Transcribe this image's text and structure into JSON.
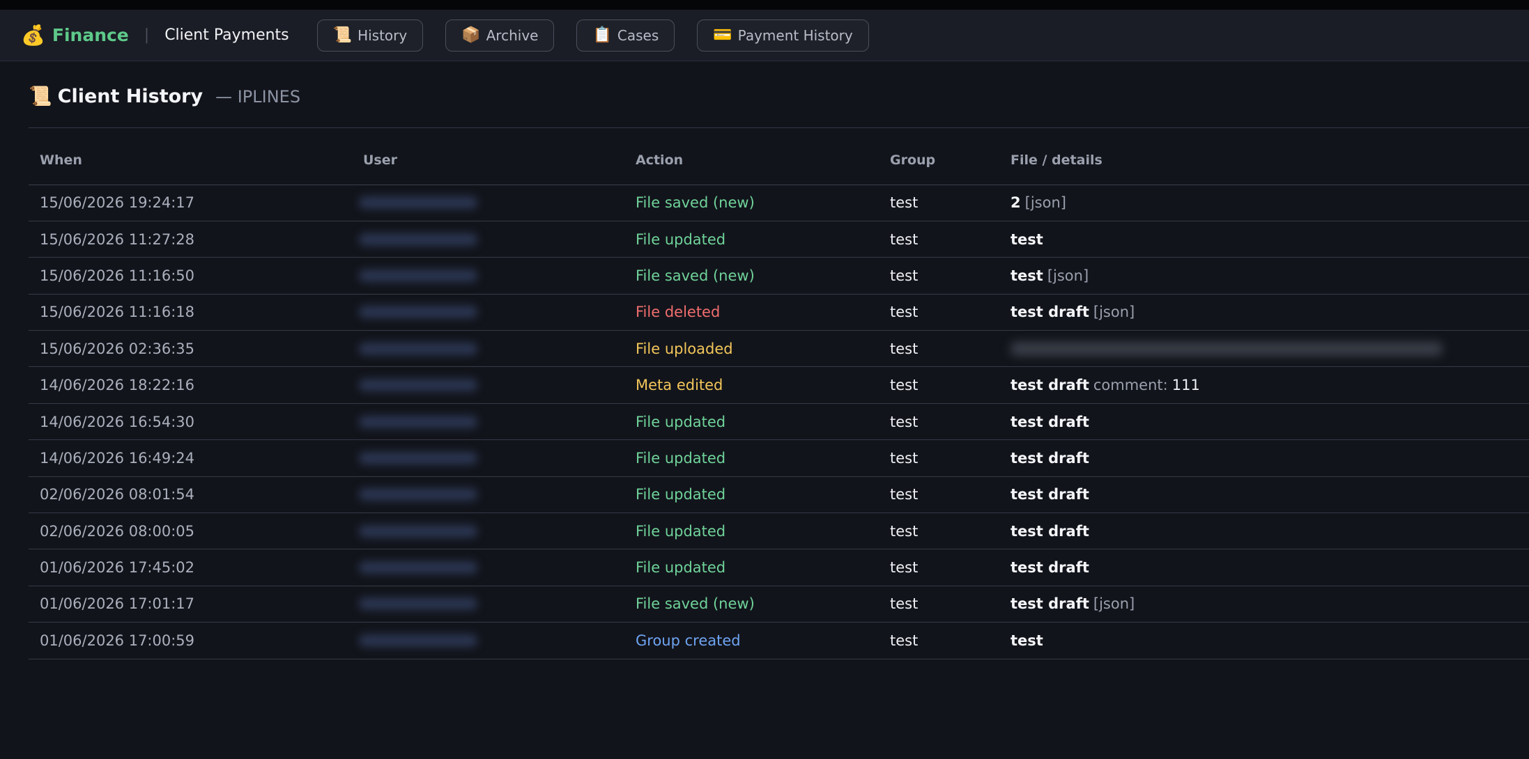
{
  "nav": {
    "brand_icon": "💰",
    "brand": "Finance",
    "separator": "|",
    "title": "Client Payments",
    "buttons": [
      {
        "icon": "📜",
        "label": "History"
      },
      {
        "icon": "📦",
        "label": "Archive"
      },
      {
        "icon": "📋",
        "label": "Cases"
      },
      {
        "icon": "💳",
        "label": "Payment History"
      }
    ]
  },
  "page": {
    "icon": "📜",
    "title": "Client History",
    "subtitle": "— IPLINES"
  },
  "table": {
    "columns": [
      "When",
      "User",
      "Action",
      "Group",
      "File / details"
    ],
    "rows": [
      {
        "when": "15/06/2026 19:24:17",
        "action": "File saved (new)",
        "action_color": "green",
        "group": "test",
        "file": "2",
        "meta": "[json]",
        "comment_label": "",
        "comment_value": "",
        "redacted": false
      },
      {
        "when": "15/06/2026 11:27:28",
        "action": "File updated",
        "action_color": "green",
        "group": "test",
        "file": "test",
        "meta": "",
        "comment_label": "",
        "comment_value": "",
        "redacted": false
      },
      {
        "when": "15/06/2026 11:16:50",
        "action": "File saved (new)",
        "action_color": "green",
        "group": "test",
        "file": "test",
        "meta": "[json]",
        "comment_label": "",
        "comment_value": "",
        "redacted": false
      },
      {
        "when": "15/06/2026 11:16:18",
        "action": "File deleted",
        "action_color": "red",
        "group": "test",
        "file": "test draft",
        "meta": "[json]",
        "comment_label": "",
        "comment_value": "",
        "redacted": false
      },
      {
        "when": "15/06/2026 02:36:35",
        "action": "File uploaded",
        "action_color": "yellow",
        "group": "test",
        "file": "",
        "meta": "",
        "comment_label": "",
        "comment_value": "",
        "redacted": true
      },
      {
        "when": "14/06/2026 18:22:16",
        "action": "Meta edited",
        "action_color": "yellow",
        "group": "test",
        "file": "test draft",
        "meta": "",
        "comment_label": "comment:",
        "comment_value": "111",
        "redacted": false
      },
      {
        "when": "14/06/2026 16:54:30",
        "action": "File updated",
        "action_color": "green",
        "group": "test",
        "file": "test draft",
        "meta": "",
        "comment_label": "",
        "comment_value": "",
        "redacted": false
      },
      {
        "when": "14/06/2026 16:49:24",
        "action": "File updated",
        "action_color": "green",
        "group": "test",
        "file": "test draft",
        "meta": "",
        "comment_label": "",
        "comment_value": "",
        "redacted": false
      },
      {
        "when": "02/06/2026 08:01:54",
        "action": "File updated",
        "action_color": "green",
        "group": "test",
        "file": "test draft",
        "meta": "",
        "comment_label": "",
        "comment_value": "",
        "redacted": false
      },
      {
        "when": "02/06/2026 08:00:05",
        "action": "File updated",
        "action_color": "green",
        "group": "test",
        "file": "test draft",
        "meta": "",
        "comment_label": "",
        "comment_value": "",
        "redacted": false
      },
      {
        "when": "01/06/2026 17:45:02",
        "action": "File updated",
        "action_color": "green",
        "group": "test",
        "file": "test draft",
        "meta": "",
        "comment_label": "",
        "comment_value": "",
        "redacted": false
      },
      {
        "when": "01/06/2026 17:01:17",
        "action": "File saved (new)",
        "action_color": "green",
        "group": "test",
        "file": "test draft",
        "meta": "[json]",
        "comment_label": "",
        "comment_value": "",
        "redacted": false
      },
      {
        "when": "01/06/2026 17:00:59",
        "action": "Group created",
        "action_color": "blue",
        "group": "test",
        "file": "test",
        "meta": "",
        "comment_label": "",
        "comment_value": "",
        "redacted": false
      }
    ]
  },
  "colors": {
    "brand": "#5ec98a",
    "green": "#6fd39a",
    "red": "#f06e6e",
    "yellow": "#f2c65a",
    "blue": "#6ea4f2"
  }
}
